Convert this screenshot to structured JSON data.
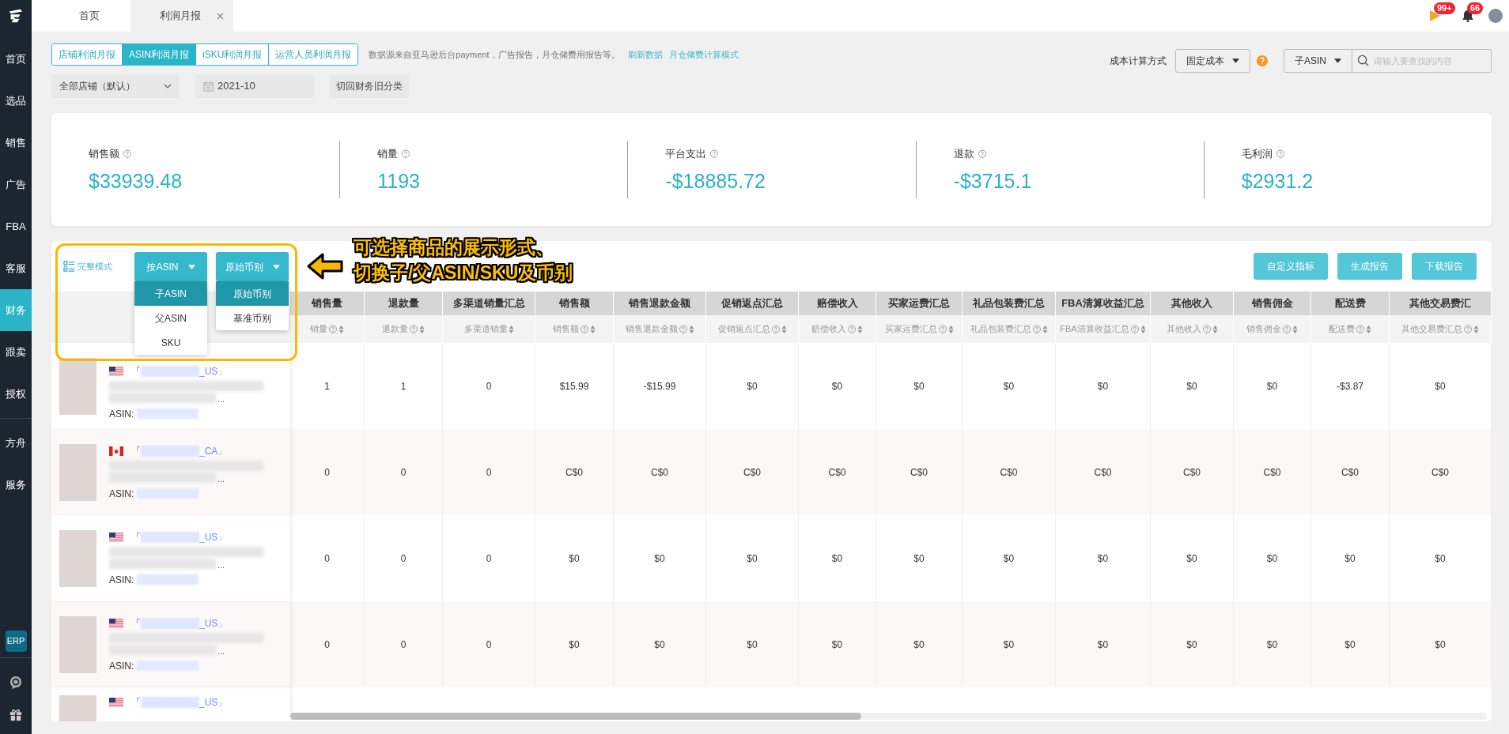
{
  "sidebar": {
    "groups": [
      {
        "items": [
          {
            "label": "首页",
            "selected": false
          },
          {
            "label": "选品",
            "selected": false
          },
          {
            "label": "销售",
            "selected": false
          },
          {
            "label": "广告",
            "selected": false
          },
          {
            "label": "FBA",
            "selected": false
          },
          {
            "label": "客服",
            "selected": false
          },
          {
            "label": "财务",
            "selected": true
          },
          {
            "label": "跟卖",
            "selected": false
          },
          {
            "label": "授权",
            "selected": false
          }
        ]
      },
      {
        "items": [
          {
            "label": "方舟",
            "selected": false
          },
          {
            "label": "服务",
            "selected": false
          }
        ]
      }
    ],
    "badge": "ERP"
  },
  "tabs": [
    {
      "label": "首页",
      "selected": false,
      "closable": false
    },
    {
      "label": "利润月报",
      "selected": true,
      "closable": true
    }
  ],
  "notifications": {
    "flag_count": "99+",
    "bell_count": "66"
  },
  "report_tabs": [
    {
      "label": "店铺利润月报",
      "selected": false
    },
    {
      "label": "ASIN利润月报",
      "selected": true
    },
    {
      "label": "iSKU利润月报",
      "selected": false
    },
    {
      "label": "运营人员利润月报",
      "selected": false
    }
  ],
  "notice": "数据源来自亚马逊后台payment，广告报告，月仓储费用报告等。",
  "links": [
    "刷新数据",
    "月仓储费计算模式"
  ],
  "filters": {
    "store": "全部店铺（默认）",
    "month": "2021-10",
    "toggle_button": "切回财务旧分类"
  },
  "cost_mode": {
    "label": "成本计算方式",
    "value": "固定成本"
  },
  "search": {
    "scope": "子ASIN",
    "placeholder": "请输入要查找的内容"
  },
  "stats": [
    {
      "label": "销售额",
      "value": "$33939.48"
    },
    {
      "label": "销量",
      "value": "1193"
    },
    {
      "label": "平台支出",
      "value": "-$18885.72"
    },
    {
      "label": "退款",
      "value": "-$3715.1"
    },
    {
      "label": "毛利润",
      "value": "$2931.2"
    }
  ],
  "toolbar": {
    "mode": "完整模式",
    "group_select": {
      "label": "按ASIN",
      "options": [
        {
          "label": "子ASIN",
          "selected": true
        },
        {
          "label": "父ASIN",
          "selected": false
        },
        {
          "label": "SKU",
          "selected": false
        }
      ]
    },
    "currency_select": {
      "label": "原始币别",
      "options": [
        {
          "label": "原始币别",
          "selected": true
        },
        {
          "label": "基准币别",
          "selected": false
        }
      ]
    },
    "buttons": [
      "自定义指标",
      "生成报告",
      "下载报告"
    ]
  },
  "annotation": {
    "lines": [
      "可选择商品的展示形式、",
      "切换子/父ASIN/SKU及币别"
    ]
  },
  "table": {
    "columns": [
      {
        "title": "销售量",
        "subtitle": "销量",
        "help": true
      },
      {
        "title": "退款量",
        "subtitle": "退款量",
        "help": true
      },
      {
        "title": "多渠道销量汇总",
        "subtitle": "多渠道销量",
        "help": false
      },
      {
        "title": "销售额",
        "subtitle": "销售额",
        "help": true
      },
      {
        "title": "销售退款金额",
        "subtitle": "销售退款金额",
        "help": true
      },
      {
        "title": "促销返点汇总",
        "subtitle": "促销返点汇总",
        "help": true
      },
      {
        "title": "赔偿收入",
        "subtitle": "赔偿收入",
        "help": true
      },
      {
        "title": "买家运费汇总",
        "subtitle": "买家运费汇总",
        "help": true
      },
      {
        "title": "礼品包装费汇总",
        "subtitle": "礼品包装费汇总",
        "help": true
      },
      {
        "title": "FBA清算收益汇总",
        "subtitle": "FBA清算收益汇总",
        "help": true
      },
      {
        "title": "其他收入",
        "subtitle": "其他收入",
        "help": true
      },
      {
        "title": "销售佣金",
        "subtitle": "销售佣金",
        "help": true
      },
      {
        "title": "配送费",
        "subtitle": "配送费",
        "help": true
      },
      {
        "title": "其他交易费汇",
        "subtitle": "其他交易费汇总",
        "help": true
      }
    ],
    "rows": [
      {
        "kind": "us",
        "bracket": "「",
        "store_suffix": "_US」",
        "ellipsis": "...",
        "asin_label": "ASIN:",
        "cells": [
          "1",
          "1",
          "0",
          "$15.99",
          "-$15.99",
          "$0",
          "$0",
          "$0",
          "$0",
          "$0",
          "$0",
          "$0",
          "-$3.87",
          "$0"
        ]
      },
      {
        "kind": "ca",
        "bracket": "「",
        "store_suffix": "_CA」",
        "ellipsis": "...",
        "asin_label": "ASIN:",
        "cells": [
          "0",
          "0",
          "0",
          "C$0",
          "C$0",
          "C$0",
          "C$0",
          "C$0",
          "C$0",
          "C$0",
          "C$0",
          "C$0",
          "C$0",
          "C$0"
        ]
      },
      {
        "kind": "us",
        "bracket": "「",
        "store_suffix": "_US」",
        "ellipsis": "...",
        "asin_label": "ASIN:",
        "cells": [
          "0",
          "0",
          "0",
          "$0",
          "$0",
          "$0",
          "$0",
          "$0",
          "$0",
          "$0",
          "$0",
          "$0",
          "$0",
          "$0"
        ]
      },
      {
        "kind": "us",
        "bracket": "「",
        "store_suffix": "_US」",
        "ellipsis": "...",
        "asin_label": "ASIN:",
        "cells": [
          "0",
          "0",
          "0",
          "$0",
          "$0",
          "$0",
          "$0",
          "$0",
          "$0",
          "$0",
          "$0",
          "$0",
          "$0",
          "$0"
        ]
      },
      {
        "kind": "us",
        "bracket": "「",
        "store_suffix": "_US」"
      }
    ]
  }
}
